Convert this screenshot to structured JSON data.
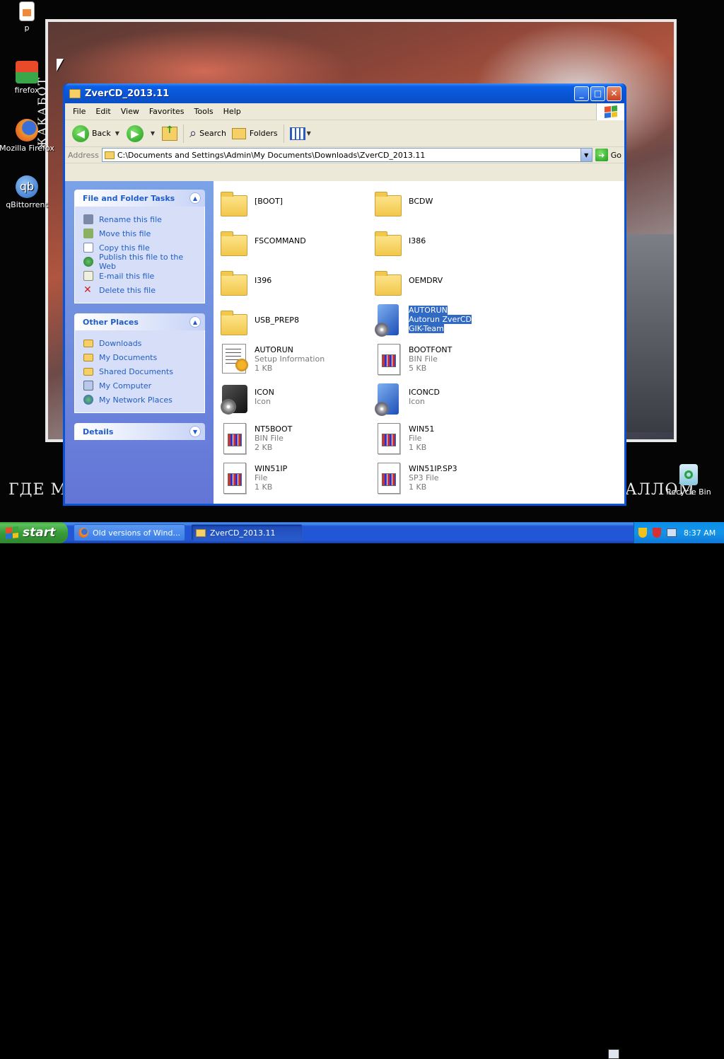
{
  "desktop": {
    "icons": [
      {
        "label": "p",
        "icon": "document-icon"
      },
      {
        "label": "firefox",
        "icon": "firefox-icon"
      },
      {
        "label": "Mozilla Firefox",
        "icon": "firefox-icon"
      },
      {
        "label": "qBittorrent",
        "icon": "qbittorrent-icon"
      },
      {
        "label": "Recycle Bin",
        "icon": "recycle-bin-icon"
      }
    ],
    "vertical_caption": "ЖАКАБОТ",
    "caption_left": "ГДЕ М",
    "caption_right": "АЛЛОМ"
  },
  "window": {
    "title": "ZverCD_2013.11",
    "menu": [
      "File",
      "Edit",
      "View",
      "Favorites",
      "Tools",
      "Help"
    ],
    "toolbar": {
      "back": "Back",
      "search": "Search",
      "folders": "Folders"
    },
    "address": {
      "label": "Address",
      "value": "C:\\Documents and Settings\\Admin\\My Documents\\Downloads\\ZverCD_2013.11",
      "go": "Go"
    }
  },
  "taskpane": {
    "file_tasks": {
      "title": "File and Folder Tasks",
      "items": [
        "Rename this file",
        "Move this file",
        "Copy this file",
        "Publish this file to the Web",
        "E-mail this file",
        "Delete this file"
      ]
    },
    "other_places": {
      "title": "Other Places",
      "items": [
        "Downloads",
        "My Documents",
        "Shared Documents",
        "My Computer",
        "My Network Places"
      ]
    },
    "details": {
      "title": "Details"
    }
  },
  "files": [
    {
      "name": "[BOOT]",
      "line2": "",
      "line3": "",
      "type": "folder"
    },
    {
      "name": "BCDW",
      "line2": "",
      "line3": "",
      "type": "folder"
    },
    {
      "name": "FSCOMMAND",
      "line2": "",
      "line3": "",
      "type": "folder"
    },
    {
      "name": "I386",
      "line2": "",
      "line3": "",
      "type": "folder"
    },
    {
      "name": "I396",
      "line2": "",
      "line3": "",
      "type": "folder"
    },
    {
      "name": "OEMDRV",
      "line2": "",
      "line3": "",
      "type": "folder"
    },
    {
      "name": "USB_PREP8",
      "line2": "",
      "line3": "",
      "type": "folder"
    },
    {
      "name": "AUTORUN",
      "line2": "Autorun ZverCD",
      "line3": "GIK-Team",
      "type": "autorun",
      "selected": true
    },
    {
      "name": "AUTORUN",
      "line2": "Setup Information",
      "line3": "1 KB",
      "type": "setup"
    },
    {
      "name": "BOOTFONT",
      "line2": "BIN File",
      "line3": "5 KB",
      "type": "doc"
    },
    {
      "name": "ICON",
      "line2": "Icon",
      "line3": "",
      "type": "disc"
    },
    {
      "name": "ICONCD",
      "line2": "Icon",
      "line3": "",
      "type": "bluedisc"
    },
    {
      "name": "NT5BOOT",
      "line2": "BIN File",
      "line3": "2 KB",
      "type": "doc"
    },
    {
      "name": "WIN51",
      "line2": "File",
      "line3": "1 KB",
      "type": "doc"
    },
    {
      "name": "WIN51IP",
      "line2": "File",
      "line3": "1 KB",
      "type": "doc"
    },
    {
      "name": "WIN51IP.SP3",
      "line2": "SP3 File",
      "line3": "1 KB",
      "type": "doc"
    }
  ],
  "taskbar": {
    "start": "start",
    "buttons": [
      "Old versions of Wind...",
      "ZverCD_2013.11"
    ],
    "clock": "8:37 AM"
  },
  "colors": {
    "xp_blue": "#0a53d9",
    "taskpane_link": "#215dc6",
    "selection": "#316ac5",
    "start_green": "#3a9c3a"
  }
}
